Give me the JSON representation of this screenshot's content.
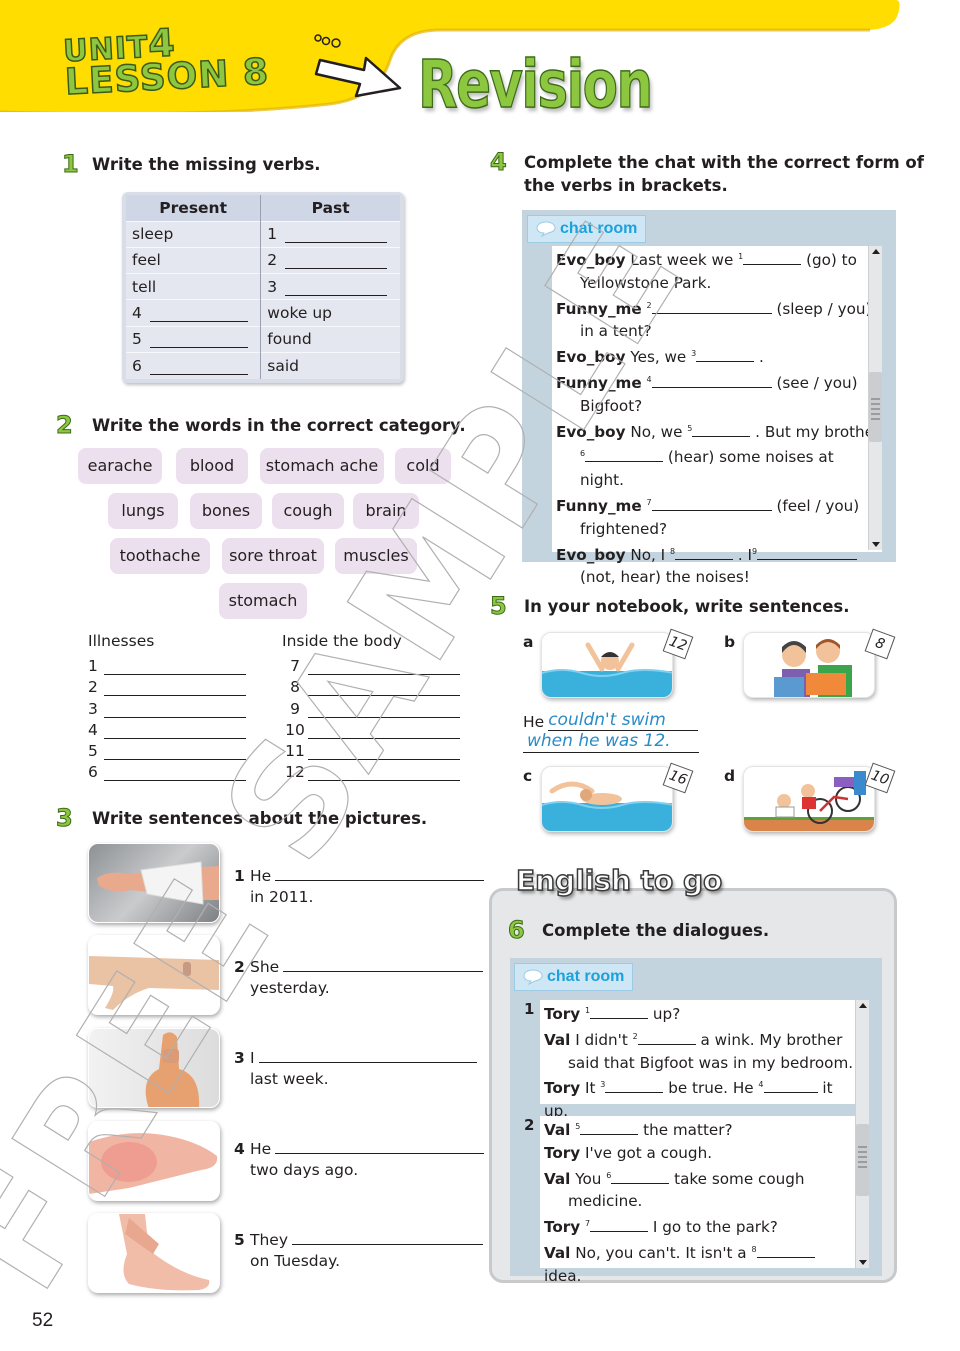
{
  "header": {
    "unit_label": "UNIT",
    "unit_number": "4",
    "lesson_label": "LESSON 8",
    "title": "Revision",
    "colors": {
      "band": "#ffdd00",
      "title_green": "#8dc63f"
    }
  },
  "ex1": {
    "number": "1",
    "instruction": "Write the missing verbs.",
    "columns": [
      "Present",
      "Past"
    ],
    "rows": [
      {
        "present": "sleep",
        "present_num": "",
        "past": "",
        "past_num": "1"
      },
      {
        "present": "feel",
        "present_num": "",
        "past": "",
        "past_num": "2"
      },
      {
        "present": "tell",
        "present_num": "",
        "past": "",
        "past_num": "3"
      },
      {
        "present": "",
        "present_num": "4",
        "past": "woke up",
        "past_num": ""
      },
      {
        "present": "",
        "present_num": "5",
        "past": "found",
        "past_num": ""
      },
      {
        "present": "",
        "present_num": "6",
        "past": "said",
        "past_num": ""
      }
    ]
  },
  "ex2": {
    "number": "2",
    "instruction": "Write the words in the correct category.",
    "words": [
      "earache",
      "blood",
      "stomach ache",
      "cold",
      "lungs",
      "bones",
      "cough",
      "brain",
      "toothache",
      "sore throat",
      "muscles",
      "stomach"
    ],
    "categories": [
      {
        "title": "Illnesses",
        "numbers": [
          "1",
          "2",
          "3",
          "4",
          "5",
          "6"
        ]
      },
      {
        "title": "Inside the body",
        "numbers": [
          "7",
          "8",
          "9",
          "10",
          "11",
          "12"
        ]
      }
    ]
  },
  "ex3": {
    "number": "3",
    "instruction": "Write sentences about the pictures.",
    "items": [
      {
        "num": "1",
        "start": "He",
        "end": "in 2011.",
        "picture": "arm-in-cast"
      },
      {
        "num": "2",
        "start": "She",
        "end": "yesterday.",
        "picture": "arm-with-cut"
      },
      {
        "num": "3",
        "start": "I",
        "end": "last week.",
        "picture": "thumb-with-plaster"
      },
      {
        "num": "4",
        "start": "He",
        "end": "two days ago.",
        "picture": "sore-foot"
      },
      {
        "num": "5",
        "start": "They",
        "end": "on Tuesday.",
        "picture": "sore-ankle"
      }
    ]
  },
  "ex4": {
    "number": "4",
    "instruction_line1": "Complete the chat with the correct form of",
    "instruction_line2": "the verbs in brackets.",
    "chat_tab": "chat room",
    "lines": [
      {
        "speaker": "Evo_boy",
        "pre": "Last week we",
        "sup": "1",
        "post": "(go) to",
        "cont": "Yellowstone Park."
      },
      {
        "speaker": "Funny_me",
        "pre": "",
        "sup": "2",
        "post": "(sleep / you)",
        "cont": "in a tent?"
      },
      {
        "speaker": "Evo_boy",
        "pre": "Yes, we",
        "sup": "3",
        "post": ".",
        "cont": ""
      },
      {
        "speaker": "Funny_me",
        "pre": "",
        "sup": "4",
        "post": "(see / you)",
        "cont": "Bigfoot?"
      },
      {
        "speaker": "Evo_boy",
        "pre": "No, we",
        "sup": "5",
        "post": ". But my brother",
        "cont_sup": "6",
        "cont": "(hear) some noises at night."
      },
      {
        "speaker": "Funny_me",
        "pre": "",
        "sup": "7",
        "post": "(feel / you)",
        "cont": "frightened?"
      },
      {
        "speaker": "Evo_boy",
        "pre": "No, I",
        "sup": "8",
        "post": ". I",
        "sup2": "9",
        "cont": "(not, hear) the noises!"
      }
    ]
  },
  "ex5": {
    "number": "5",
    "instruction": "In your notebook, write sentences.",
    "items": [
      {
        "letter": "a",
        "age": "12",
        "picture": "boy-struggling-in-water"
      },
      {
        "letter": "b",
        "age": "8",
        "picture": "children-reading"
      },
      {
        "letter": "c",
        "age": "16",
        "picture": "swimmer"
      },
      {
        "letter": "d",
        "age": "10",
        "picture": "bike-crash"
      }
    ],
    "example_start": "He",
    "example_line1": "couldn't swim",
    "example_line2": "when he was 12."
  },
  "english_to_go": {
    "title": "English to go",
    "ex6_number": "6",
    "instruction": "Complete the dialogues.",
    "chat_tab": "chat room",
    "dialogues": [
      {
        "num": "1",
        "lines": [
          {
            "speaker": "Tory",
            "pre": "",
            "sup": "1",
            "post": "up?"
          },
          {
            "speaker": "Val",
            "pre": "I didn't",
            "sup": "2",
            "post": "a wink. My brother",
            "cont": "said that Bigfoot was in my bedroom."
          },
          {
            "speaker": "Tory",
            "pre": "It",
            "sup": "3",
            "post": "be true. He",
            "sup2": "4",
            "post2": "it up."
          }
        ]
      },
      {
        "num": "2",
        "lines": [
          {
            "speaker": "Val",
            "pre": "",
            "sup": "5",
            "post": "the matter?"
          },
          {
            "speaker": "Tory",
            "pre": "I've got a cough.",
            "sup": "",
            "post": ""
          },
          {
            "speaker": "Val",
            "pre": "You",
            "sup": "6",
            "post": "take some cough",
            "cont": "medicine."
          },
          {
            "speaker": "Tory",
            "pre": "",
            "sup": "7",
            "post": "I go to the park?"
          },
          {
            "speaker": "Val",
            "pre": "No, you can't. It isn't a",
            "sup": "8",
            "post": "idea."
          }
        ]
      }
    ]
  },
  "page_number": "52",
  "watermark": "FREE SAMPLE"
}
